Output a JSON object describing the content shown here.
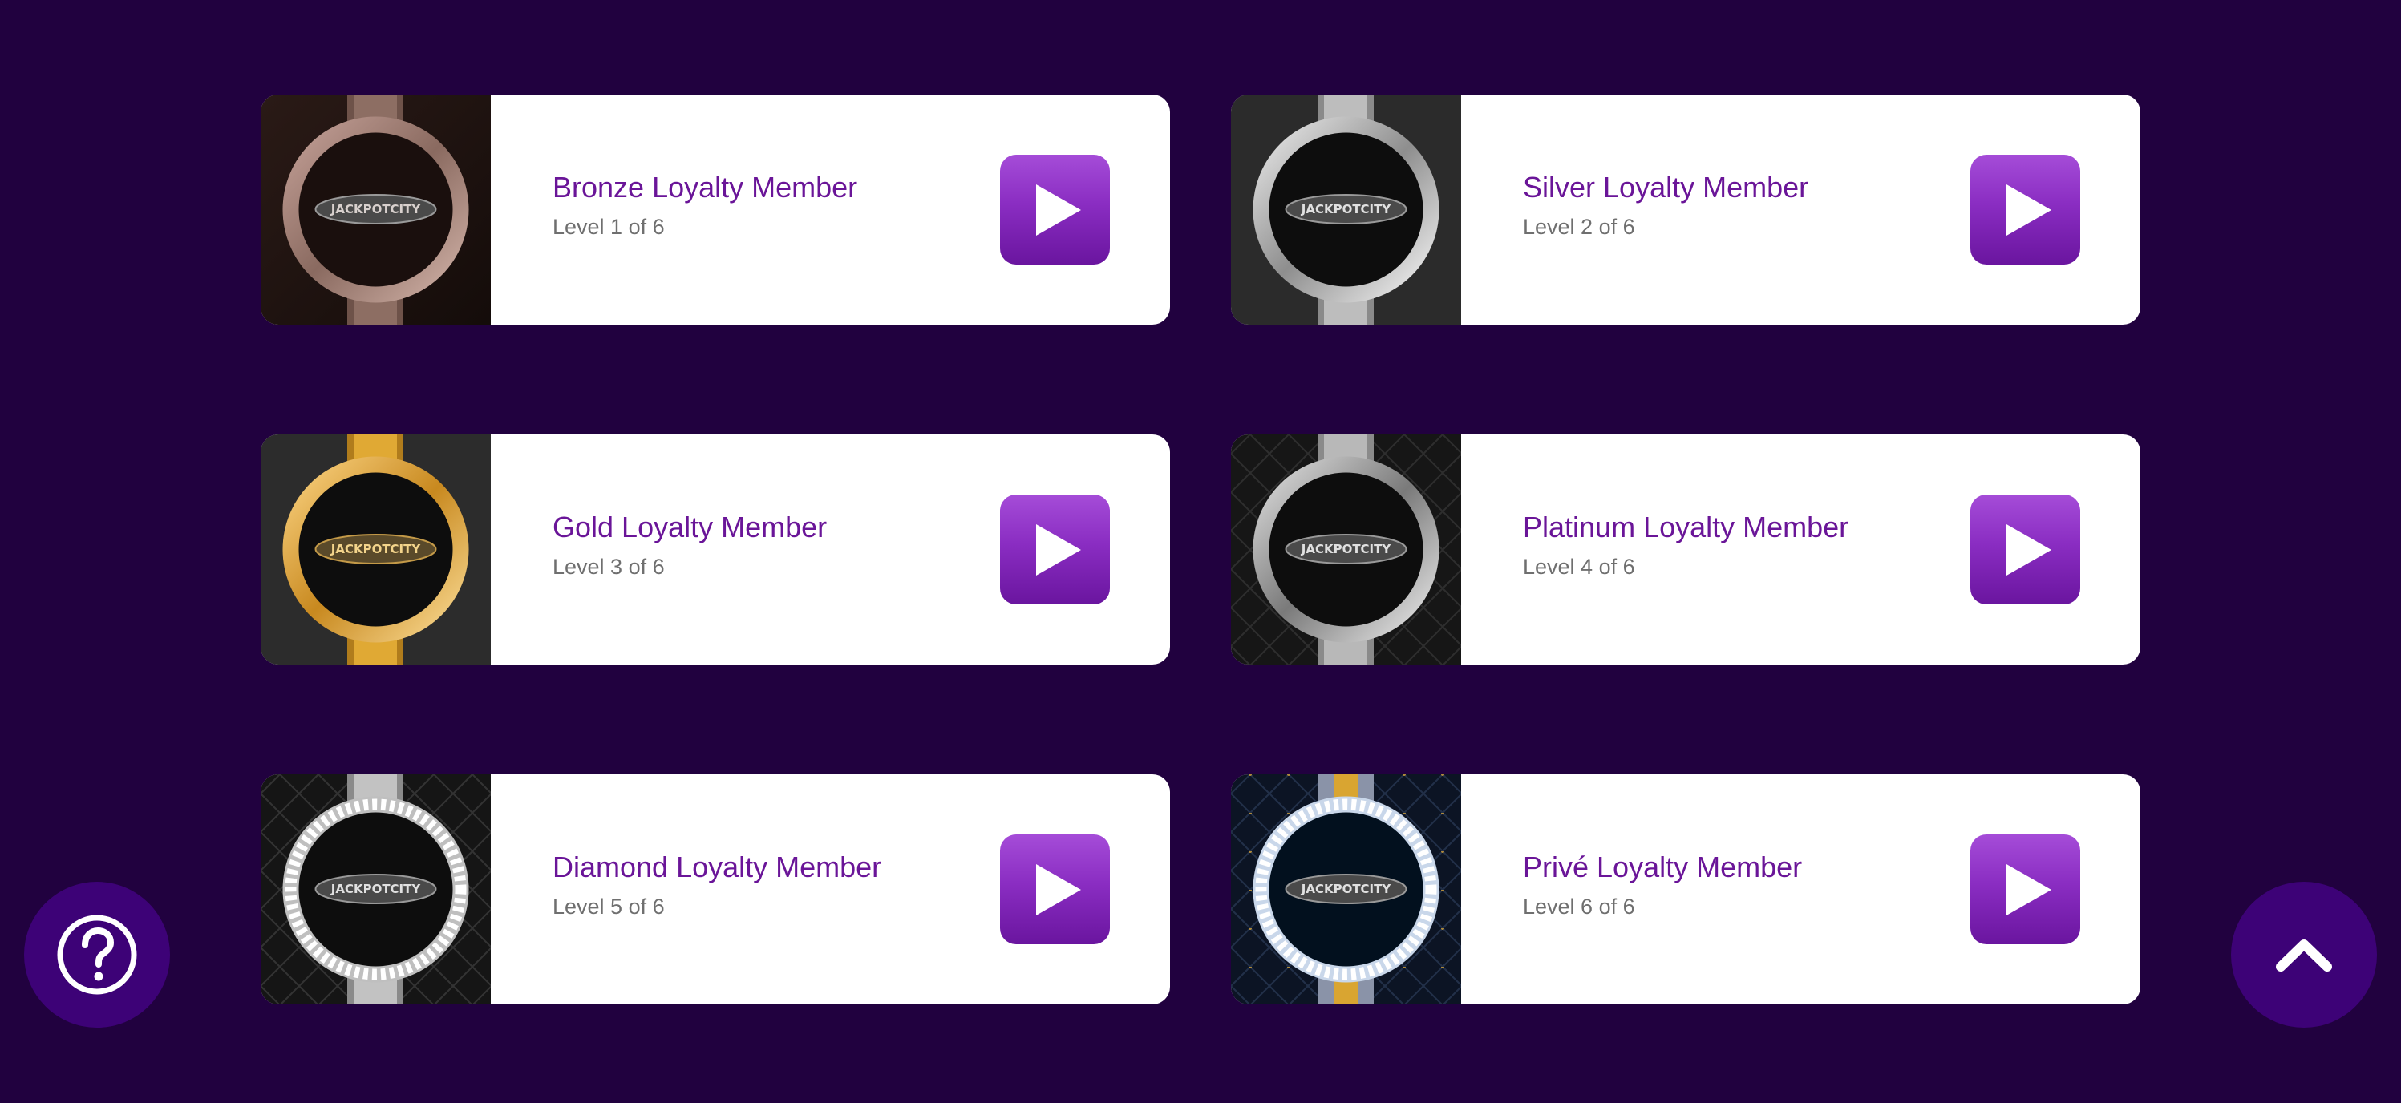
{
  "members": [
    {
      "title": "Bronze Loyalty Member",
      "level": "Level 1 of 6",
      "tier": "bronze",
      "brand": "JACKPOTCITY"
    },
    {
      "title": "Silver Loyalty Member",
      "level": "Level 2 of 6",
      "tier": "silver",
      "brand": "JACKPOTCITY"
    },
    {
      "title": "Gold Loyalty Member",
      "level": "Level 3 of 6",
      "tier": "gold",
      "brand": "JACKPOTCITY"
    },
    {
      "title": "Platinum Loyalty Member",
      "level": "Level 4 of 6",
      "tier": "platinum",
      "brand": "JACKPOTCITY"
    },
    {
      "title": "Diamond Loyalty Member",
      "level": "Level 5 of 6",
      "tier": "diamond",
      "brand": "JACKPOTCITY"
    },
    {
      "title": "Privé Loyalty Member",
      "level": "Level 6 of 6",
      "tier": "prive",
      "brand": "JACKPOTCITY"
    }
  ],
  "icons": {
    "play": "play-icon",
    "help": "question-mark-icon",
    "scroll_top": "chevron-up-icon"
  },
  "colors": {
    "background": "#21013f",
    "card": "#ffffff",
    "title": "#6a1598",
    "subtitle": "#6f6f6f",
    "play_button": "#8a2dc2",
    "floating_button": "#3d0277"
  }
}
